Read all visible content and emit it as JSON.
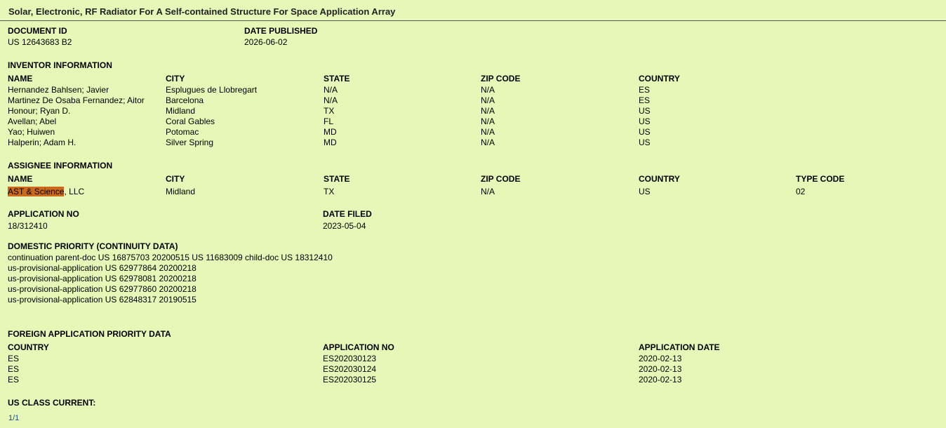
{
  "title": "Solar, Electronic, RF Radiator For A Self-contained Structure For Space Application Array",
  "document_id": {
    "label": "DOCUMENT ID",
    "value": "US 12643683 B2"
  },
  "date_published": {
    "label": "DATE PUBLISHED",
    "value": "2026-06-02"
  },
  "inventor": {
    "heading": "INVENTOR INFORMATION",
    "columns": [
      "NAME",
      "CITY",
      "STATE",
      "ZIP CODE",
      "COUNTRY"
    ],
    "rows": [
      [
        "Hernandez Bahlsen; Javier",
        "Esplugues de Llobregart",
        "N/A",
        "N/A",
        "ES"
      ],
      [
        "Martinez De Osaba Fernandez; Aitor",
        "Barcelona",
        "N/A",
        "N/A",
        "ES"
      ],
      [
        "Honour; Ryan D.",
        "Midland",
        "TX",
        "N/A",
        "US"
      ],
      [
        "Avellan; Abel",
        "Coral Gables",
        "FL",
        "N/A",
        "US"
      ],
      [
        "Yao; Huiwen",
        "Potomac",
        "MD",
        "N/A",
        "US"
      ],
      [
        "Halperin; Adam H.",
        "Silver Spring",
        "MD",
        "N/A",
        "US"
      ]
    ]
  },
  "assignee": {
    "heading": "ASSIGNEE INFORMATION",
    "columns": [
      "NAME",
      "CITY",
      "STATE",
      "ZIP CODE",
      "COUNTRY",
      "TYPE CODE"
    ],
    "name_highlight": "AST & Science",
    "name_rest": ", LLC",
    "city": "Midland",
    "state": "TX",
    "zip": "N/A",
    "country": "US",
    "type_code": "02"
  },
  "application": {
    "no_label": "APPLICATION NO",
    "no_value": "18/312410",
    "filed_label": "DATE FILED",
    "filed_value": "2023-05-04"
  },
  "domestic_priority": {
    "heading": "DOMESTIC PRIORITY (CONTINUITY DATA)",
    "lines": [
      "continuation parent-doc US 16875703 20200515 US 11683009 child-doc US 18312410",
      "us-provisional-application US 62977864 20200218",
      "us-provisional-application US 62978081 20200218",
      "us-provisional-application US 62977860 20200218",
      "us-provisional-application US 62848317 20190515"
    ]
  },
  "foreign_priority": {
    "heading": "FOREIGN APPLICATION PRIORITY DATA",
    "columns": [
      "COUNTRY",
      "APPLICATION NO",
      "APPLICATION DATE"
    ],
    "rows": [
      [
        "ES",
        "ES202030123",
        "2020-02-13"
      ],
      [
        "ES",
        "ES202030124",
        "2020-02-13"
      ],
      [
        "ES",
        "ES202030125",
        "2020-02-13"
      ]
    ]
  },
  "us_class": {
    "heading": "US CLASS CURRENT:"
  },
  "pager": "1/1"
}
